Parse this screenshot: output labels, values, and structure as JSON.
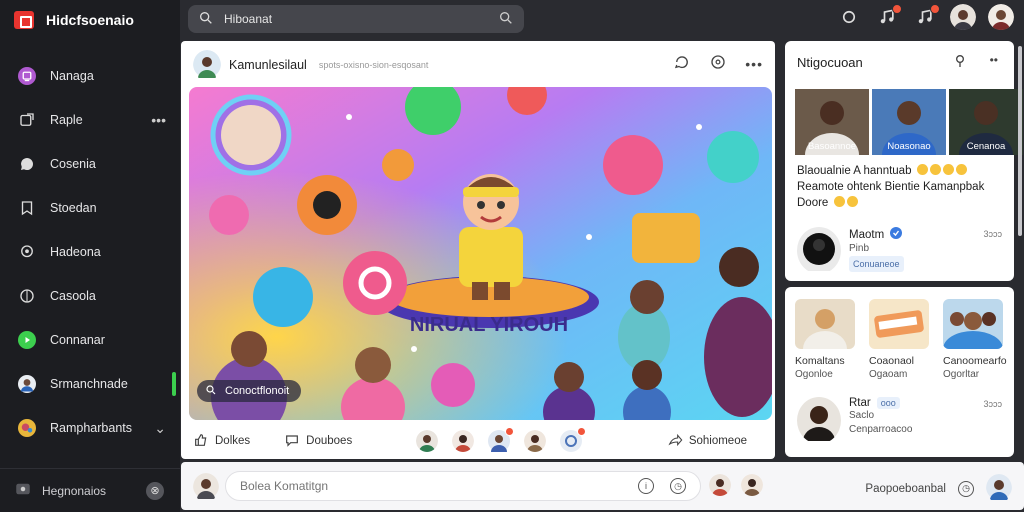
{
  "app": {
    "name": "Hidcfsoenaio"
  },
  "search": {
    "value": "Hiboanat"
  },
  "sidebar": {
    "items": [
      {
        "label": "Nanaga",
        "icon": "profile-icon"
      },
      {
        "label": "Raple",
        "icon": "post-icon",
        "extra": "•••"
      },
      {
        "label": "Cosenia",
        "icon": "chat-icon"
      },
      {
        "label": "Stoedan",
        "icon": "bookmark-icon"
      },
      {
        "label": "Hadeona",
        "icon": "location-icon"
      },
      {
        "label": "Casoola",
        "icon": "globe-icon"
      },
      {
        "label": "Connanar",
        "icon": "play-icon"
      },
      {
        "label": "Srmanchnade",
        "icon": "user-avatar"
      },
      {
        "label": "Rampharbants",
        "icon": "group-avatar",
        "extra": "⌄"
      }
    ],
    "bottom_label": "Hegnonaios",
    "bottom_action": "⊗"
  },
  "post": {
    "author": "Kamunlesilaul",
    "subtitle": "spots-oxisno-sion-esqosant",
    "image_label": "Conoctflonoit",
    "banner_text": "NIRUAL YIROUH",
    "footer": {
      "like_label": "Dolkes",
      "comment_label": "Douboes",
      "share_label": "Sohiomeoe"
    }
  },
  "right_panel": {
    "title": "Ntigocuoan",
    "thumbs": [
      {
        "caption": "Basoannoe"
      },
      {
        "caption": "Noasonao"
      },
      {
        "caption": "Cenanoa"
      }
    ],
    "text_lines": [
      "Blaoualnie A hanntuab",
      "Reamote ohtenk  Bientie Kamanpbak",
      "Doore"
    ],
    "people": [
      {
        "name": "Maotm",
        "meta1": "Pinb",
        "tag": "Conuaneoe",
        "time": "3ɔɔɔ"
      },
      {
        "name": "Rtar",
        "tag": "ooo",
        "meta1": "Saclo",
        "meta2": "Cenparroacoo",
        "time": "3ɔɔɔ"
      }
    ],
    "suggestions": [
      {
        "name": "Komaltans",
        "sub": "Ogonloe"
      },
      {
        "name": "Coaonaol",
        "sub": "Ogaoam"
      },
      {
        "name": "Canoomearfo",
        "sub": "Ogorltar"
      }
    ]
  },
  "bottom": {
    "comment_placeholder": "Bolea Komatitgn",
    "right_label": "Paopoeboanbal"
  },
  "colors": {
    "accent_green": "#3ccf4e",
    "badge_red": "#f2553b",
    "sidebar_bg": "#1c1d21"
  }
}
